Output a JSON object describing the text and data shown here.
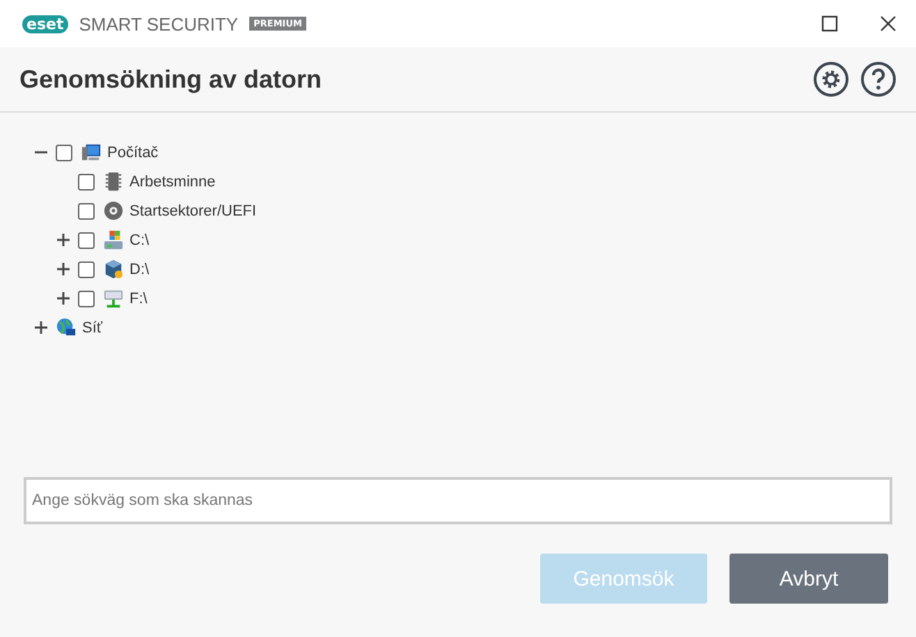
{
  "window": {
    "logo": "eset",
    "product": "SMART SECURITY",
    "edition": "PREMIUM"
  },
  "header": {
    "title": "Genomsökning av datorn"
  },
  "tree": [
    {
      "label": "Počítač",
      "kind": "computer",
      "checked": false,
      "expanded": true,
      "children": [
        {
          "label": "Arbetsminne",
          "kind": "memory",
          "checked": false
        },
        {
          "label": "Startsektorer/UEFI",
          "kind": "disc",
          "checked": false
        },
        {
          "label": "C:\\",
          "kind": "system-drive",
          "checked": false,
          "expanded": false
        },
        {
          "label": "D:\\",
          "kind": "box-drive",
          "checked": false,
          "expanded": false
        },
        {
          "label": "F:\\",
          "kind": "network-drive",
          "checked": false,
          "expanded": false
        }
      ]
    },
    {
      "label": "Síť",
      "kind": "network",
      "expanded": false
    }
  ],
  "path_field": {
    "placeholder": "Ange sökväg som ska skannas"
  },
  "buttons": [
    {
      "label": "Genomsök",
      "disabled": true
    },
    {
      "label": "Avbryt",
      "disabled": false
    }
  ]
}
